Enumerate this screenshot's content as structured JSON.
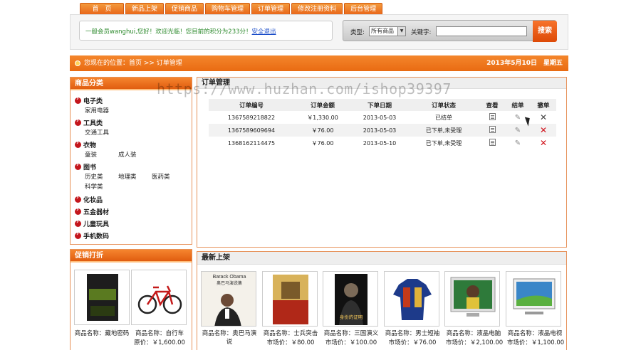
{
  "nav": [
    "首　页",
    "新品上架",
    "促销商品",
    "购物车管理",
    "订单管理",
    "修改注册资料",
    "后台管理"
  ],
  "welcome": {
    "text": "一般会员wanghui,您好！欢迎光临！您目前的积分为233分！",
    "logout": "安全退出"
  },
  "search": {
    "type_label": "类型:",
    "type_value": "所有商品",
    "keyword_label": "关键字:",
    "button": "搜索"
  },
  "breadcrumb": {
    "text": "您现在的位置：首页 >> 订单管理",
    "date": "2013年5月10日　星期五"
  },
  "category_panel": {
    "title": "商品分类",
    "groups": [
      {
        "name": "电子类",
        "subs": [
          "家用电器"
        ]
      },
      {
        "name": "工具类",
        "subs": [
          "交通工具"
        ]
      },
      {
        "name": "衣物",
        "subs": [
          "童装",
          "成人装"
        ]
      },
      {
        "name": "图书",
        "subs": [
          "历史类",
          "地理类",
          "医药类",
          "科学类"
        ]
      },
      {
        "name": "化妆品",
        "subs": []
      },
      {
        "name": "五金器材",
        "subs": []
      },
      {
        "name": "儿童玩具",
        "subs": []
      },
      {
        "name": "手机数码",
        "subs": []
      }
    ]
  },
  "promo_panel": {
    "title": "促销打折",
    "items": [
      {
        "name": "商品名称：藏地密码",
        "price_label": ""
      },
      {
        "name": "商品名称：自行车",
        "price_label": "原价：￥1,600.00"
      }
    ]
  },
  "orders": {
    "title": "订单管理",
    "columns": [
      "订单编号",
      "订单金额",
      "下单日期",
      "订单状态",
      "查看",
      "结单",
      "撤单"
    ],
    "rows": [
      {
        "id": "1367589218822",
        "amount": "￥1,330.00",
        "date": "2013-05-03",
        "status": "已结单"
      },
      {
        "id": "1367589609694",
        "amount": "￥76.00",
        "date": "2013-05-03",
        "status": "已下单,未受理"
      },
      {
        "id": "1368162114475",
        "amount": "￥76.00",
        "date": "2013-05-10",
        "status": "已下单,未受理"
      }
    ]
  },
  "watermark": "https://www.huzhan.com/ishop39397",
  "new_panel": {
    "title": "最新上架",
    "items": [
      {
        "name": "商品名称：奥巴马演说",
        "price": "",
        "cover_title": "Barack Obama",
        "cover_sub": "奥巴马演说集"
      },
      {
        "name": "商品名称：士兵突击",
        "price": "市场价：￥80.00"
      },
      {
        "name": "商品名称：三国演义",
        "price": "市场价：￥100.00",
        "cover_title": "身份的证明"
      },
      {
        "name": "商品名称：男士短袖",
        "price": "市场价：￥76.00"
      },
      {
        "name": "商品名称：液晶电脑",
        "price": "市场价：￥2,100.00"
      },
      {
        "name": "商品名称：液晶电视",
        "price": "市场价：￥1,100.00"
      }
    ]
  },
  "colors": {
    "accent": "#e96b12",
    "danger": "#c4161c",
    "link": "#1b4dc9"
  }
}
